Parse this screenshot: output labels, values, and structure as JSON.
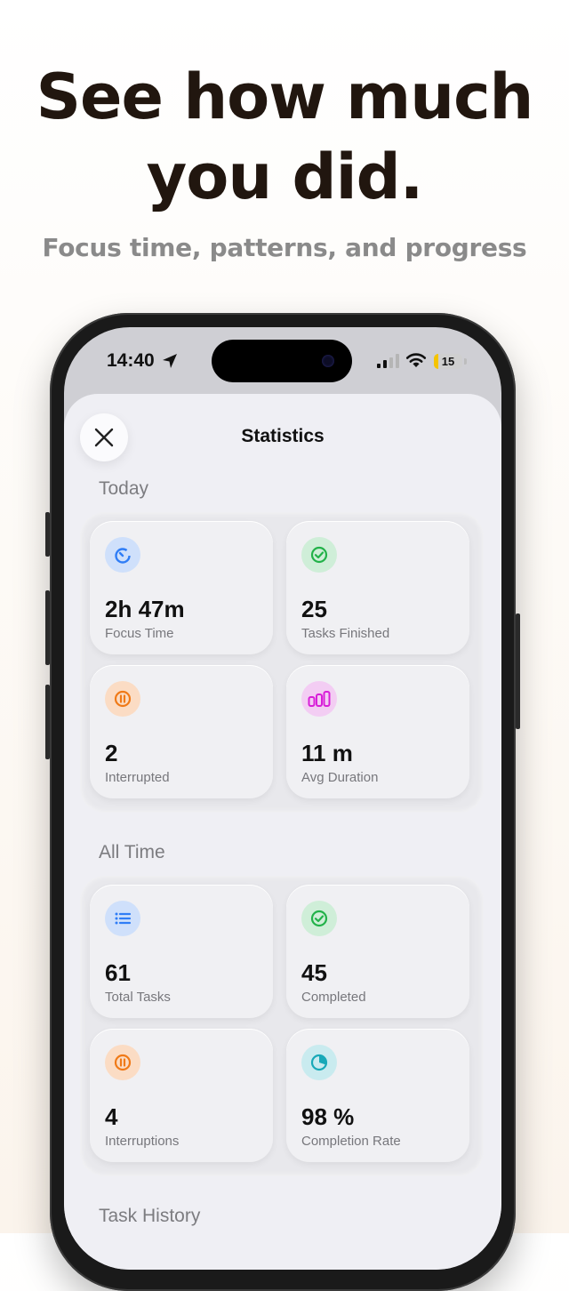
{
  "headline": {
    "line1": "See how much",
    "line2": "you did.",
    "sub": "Focus time, patterns, and progress"
  },
  "status_bar": {
    "time": "14:40",
    "battery": "15"
  },
  "sheet": {
    "title": "Statistics"
  },
  "today": {
    "label": "Today",
    "cards": [
      {
        "value": "2h 47m",
        "label": "Focus Time",
        "icon": "timer-icon",
        "color": "#2f7df6"
      },
      {
        "value": "25",
        "label": "Tasks Finished",
        "icon": "check-circle-icon",
        "color": "#23b24a"
      },
      {
        "value": "2",
        "label": "Interrupted",
        "icon": "pause-circle-icon",
        "color": "#f07a18"
      },
      {
        "value": "11 m",
        "label": "Avg Duration",
        "icon": "bar-chart-icon",
        "color": "#d81fd8"
      }
    ]
  },
  "all_time": {
    "label": "All Time",
    "cards": [
      {
        "value": "61",
        "label": "Total Tasks",
        "icon": "list-icon",
        "color": "#2f7df6"
      },
      {
        "value": "45",
        "label": "Completed",
        "icon": "check-circle-icon",
        "color": "#23b24a"
      },
      {
        "value": "4",
        "label": "Interruptions",
        "icon": "pause-circle-icon",
        "color": "#f07a18"
      },
      {
        "value": "98 %",
        "label": "Completion Rate",
        "icon": "pie-chart-icon",
        "color": "#19a9b8"
      }
    ]
  },
  "task_history": {
    "label": "Task History"
  }
}
